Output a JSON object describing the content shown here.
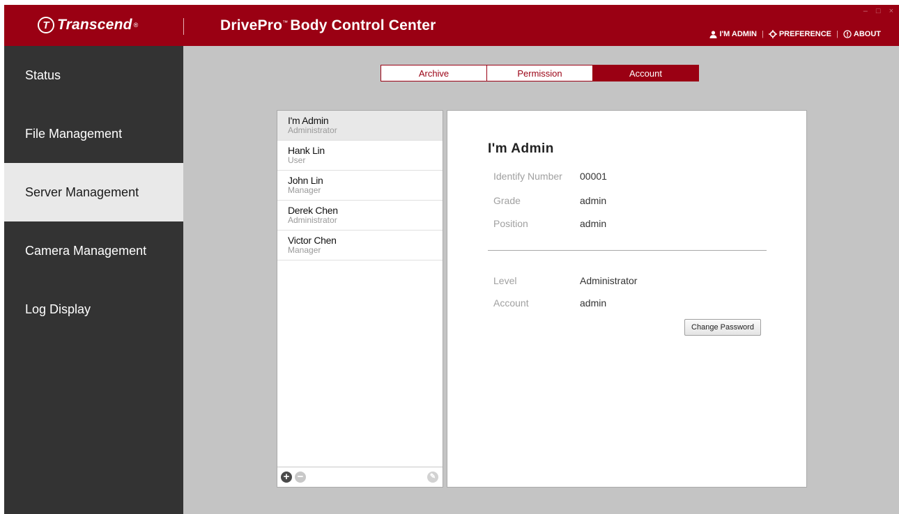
{
  "header": {
    "logo_text": "Transcend",
    "logo_mark": "T",
    "logo_reg": "®",
    "app_title_main": "DrivePro",
    "app_title_tm": "™",
    "app_title_rest": "Body Control Center",
    "window_controls": [
      "–",
      "□",
      "×"
    ],
    "menu": [
      {
        "label": "I'M ADMIN",
        "icon": "user-icon"
      },
      {
        "label": "PREFERENCE",
        "icon": "gear-icon"
      },
      {
        "label": "ABOUT",
        "icon": "info-icon"
      }
    ],
    "separator": "|"
  },
  "sidebar": {
    "items": [
      {
        "label": "Status",
        "active": false
      },
      {
        "label": "File Management",
        "active": false
      },
      {
        "label": "Server Management",
        "active": true
      },
      {
        "label": "Camera Management",
        "active": false
      },
      {
        "label": "Log Display",
        "active": false
      }
    ]
  },
  "tabs": [
    {
      "label": "Archive",
      "active": false
    },
    {
      "label": "Permission",
      "active": false
    },
    {
      "label": "Account",
      "active": true
    }
  ],
  "users": [
    {
      "name": "I'm Admin",
      "role": "Administrator",
      "selected": true
    },
    {
      "name": "Hank Lin",
      "role": "User",
      "selected": false
    },
    {
      "name": "John Lin",
      "role": "Manager",
      "selected": false
    },
    {
      "name": "Derek Chen",
      "role": "Administrator",
      "selected": false
    },
    {
      "name": "Victor Chen",
      "role": "Manager",
      "selected": false
    }
  ],
  "list_footer": {
    "add_glyph": "+",
    "remove_glyph": "−",
    "edit_glyph": "✎"
  },
  "detail": {
    "title": "I'm Admin",
    "identify_label": "Identify Number",
    "identify_value": "00001",
    "grade_label": "Grade",
    "grade_value": "admin",
    "position_label": "Position",
    "position_value": "admin",
    "level_label": "Level",
    "level_value": "Administrator",
    "account_label": "Account",
    "account_value": "admin",
    "change_password_label": "Change Password"
  },
  "colors": {
    "brand": "#9a0013",
    "sidebar_bg": "#333333",
    "content_bg": "#c4c4c4"
  }
}
